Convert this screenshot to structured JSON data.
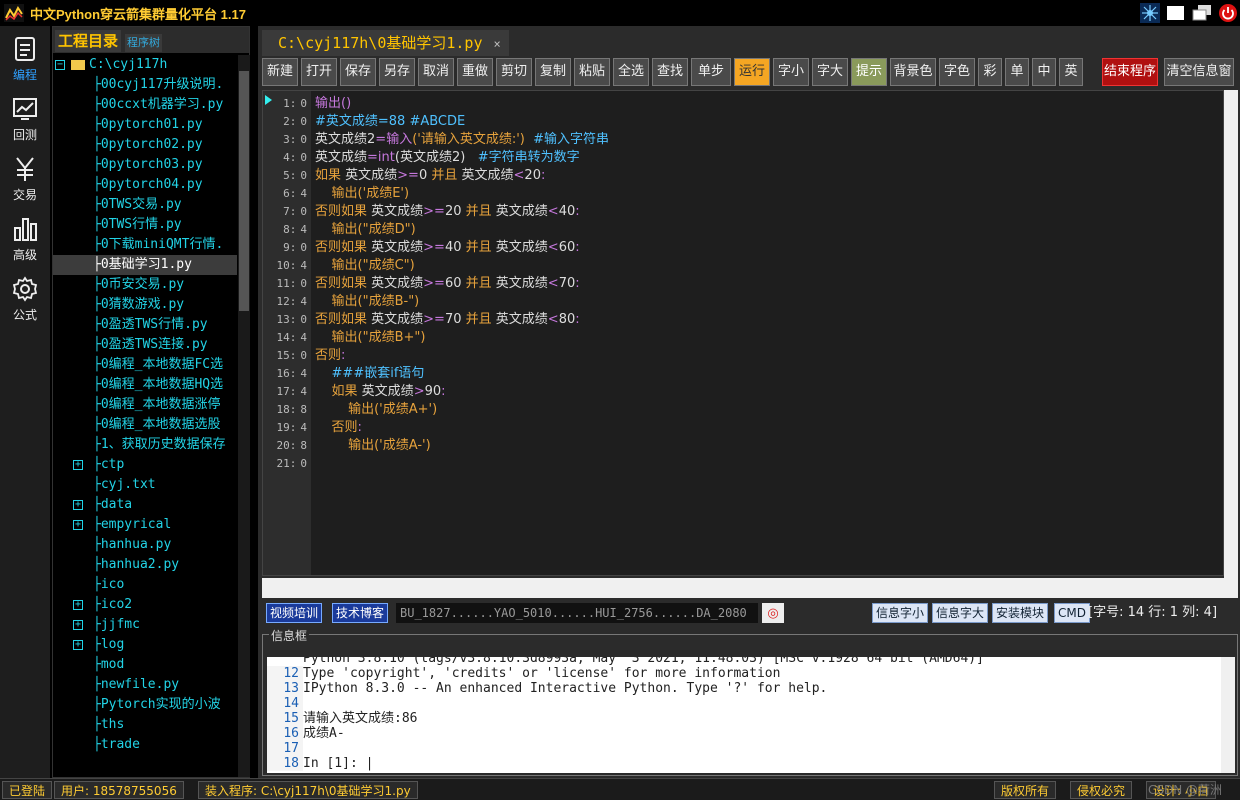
{
  "titlebar": {
    "title": "中文Python穿云箭集群量化平台 1.17"
  },
  "rail": [
    {
      "label": "编程",
      "icon": "document-icon"
    },
    {
      "label": "回测",
      "icon": "chart-line-icon"
    },
    {
      "label": "交易",
      "icon": "yen-icon"
    },
    {
      "label": "高级",
      "icon": "bar-chart-icon"
    },
    {
      "label": "公式",
      "icon": "gear-icon"
    }
  ],
  "project": {
    "tab_main": "工程目录",
    "tab_tree": "程序树",
    "root": "C:\\cyj117h",
    "items": [
      {
        "label": "├00cyj117升级说明.",
        "expand": false
      },
      {
        "label": "├00ccxt机器学习.py",
        "expand": false
      },
      {
        "label": "├0pytorch01.py",
        "expand": false
      },
      {
        "label": "├0pytorch02.py",
        "expand": false
      },
      {
        "label": "├0pytorch03.py",
        "expand": false
      },
      {
        "label": "├0pytorch04.py",
        "expand": false
      },
      {
        "label": "├0TWS交易.py",
        "expand": false
      },
      {
        "label": "├0TWS行情.py",
        "expand": false
      },
      {
        "label": "├0下载miniQMT行情.",
        "expand": false
      },
      {
        "label": "├0基础学习1.py",
        "expand": false,
        "selected": true
      },
      {
        "label": "├0币安交易.py",
        "expand": false
      },
      {
        "label": "├0猜数游戏.py",
        "expand": false
      },
      {
        "label": "├0盈透TWS行情.py",
        "expand": false
      },
      {
        "label": "├0盈透TWS连接.py",
        "expand": false
      },
      {
        "label": "├0编程_本地数据FC选",
        "expand": false
      },
      {
        "label": "├0编程_本地数据HQ选",
        "expand": false
      },
      {
        "label": "├0编程_本地数据涨停",
        "expand": false
      },
      {
        "label": "├0编程_本地数据选股",
        "expand": false
      },
      {
        "label": "├1、获取历史数据保存",
        "expand": false
      },
      {
        "label": "├ctp",
        "expand": true
      },
      {
        "label": "├cyj.txt",
        "expand": false
      },
      {
        "label": "├data",
        "expand": true
      },
      {
        "label": "├empyrical",
        "expand": true
      },
      {
        "label": "├hanhua.py",
        "expand": false
      },
      {
        "label": "├hanhua2.py",
        "expand": false
      },
      {
        "label": "├ico",
        "expand": false
      },
      {
        "label": "├ico2",
        "expand": true
      },
      {
        "label": "├jjfmc",
        "expand": true
      },
      {
        "label": "├log",
        "expand": true
      },
      {
        "label": "├mod",
        "expand": false
      },
      {
        "label": "├newfile.py",
        "expand": false
      },
      {
        "label": "├Pytorch实现的小波",
        "expand": false
      },
      {
        "label": "├ths",
        "expand": false
      },
      {
        "label": "├trade",
        "expand": false
      }
    ]
  },
  "editor": {
    "file_tab": "C:\\cyj117h\\0基础学习1.py",
    "close_glyph": "×",
    "toolbar": [
      "新建",
      "打开",
      "保存",
      "另存",
      "取消",
      "重做",
      "剪切",
      "复制",
      "粘贴",
      "全选",
      "查找",
      "单步",
      "运行",
      "字小",
      "字大",
      "提示",
      "背景色",
      "字色",
      "彩",
      "单",
      "中",
      "英"
    ],
    "stop_button": "结束程序",
    "clear_button": "清空信息窗",
    "lines": [
      {
        "no": "1:",
        "indent": "0",
        "tokens": [
          [
            "fn",
            "输出"
          ],
          [
            "fn",
            "()"
          ]
        ]
      },
      {
        "no": "2:",
        "indent": "0",
        "tokens": [
          [
            "cm",
            "#英文成绩=88 #ABCDE"
          ]
        ]
      },
      {
        "no": "3:",
        "indent": "0",
        "tokens": [
          [
            "",
            "英文成绩2"
          ],
          [
            "fn",
            "="
          ],
          [
            "fn",
            "输入"
          ],
          [
            "str",
            "('请输入英文成绩:')"
          ],
          [
            "",
            "  "
          ],
          [
            "cm",
            "#输入字符串"
          ]
        ]
      },
      {
        "no": "4:",
        "indent": "0",
        "tokens": [
          [
            "",
            "英文成绩"
          ],
          [
            "fn",
            "="
          ],
          [
            "fn",
            "int"
          ],
          [
            "",
            "(英文成绩2)   "
          ],
          [
            "cm",
            "#字符串转为数字"
          ]
        ]
      },
      {
        "no": "5:",
        "indent": "0",
        "tokens": [
          [
            "kw",
            "如果"
          ],
          [
            "",
            " 英文成绩"
          ],
          [
            "fn",
            ">="
          ],
          [
            "",
            "0 "
          ],
          [
            "kw",
            "并且"
          ],
          [
            "",
            " 英文成绩"
          ],
          [
            "fn",
            "<"
          ],
          [
            "",
            "20"
          ],
          [
            "fn",
            ":"
          ]
        ]
      },
      {
        "no": "6:",
        "indent": "4",
        "tokens": [
          [
            "",
            "    "
          ],
          [
            "kw",
            "输出"
          ],
          [
            "str",
            "('成绩E')"
          ]
        ]
      },
      {
        "no": "7:",
        "indent": "0",
        "tokens": [
          [
            "kw",
            "否则如果"
          ],
          [
            "",
            " 英文成绩"
          ],
          [
            "fn",
            ">="
          ],
          [
            "",
            "20 "
          ],
          [
            "kw",
            "并且"
          ],
          [
            "",
            " 英文成绩"
          ],
          [
            "fn",
            "<"
          ],
          [
            "",
            "40"
          ],
          [
            "fn",
            ":"
          ]
        ]
      },
      {
        "no": "8:",
        "indent": "4",
        "tokens": [
          [
            "",
            "    "
          ],
          [
            "kw",
            "输出"
          ],
          [
            "str",
            "(\"成绩D\")"
          ]
        ]
      },
      {
        "no": "9:",
        "indent": "0",
        "tokens": [
          [
            "kw",
            "否则如果"
          ],
          [
            "",
            " 英文成绩"
          ],
          [
            "fn",
            ">="
          ],
          [
            "",
            "40 "
          ],
          [
            "kw",
            "并且"
          ],
          [
            "",
            " 英文成绩"
          ],
          [
            "fn",
            "<"
          ],
          [
            "",
            "60"
          ],
          [
            "fn",
            ":"
          ]
        ]
      },
      {
        "no": "10:",
        "indent": "4",
        "tokens": [
          [
            "",
            "    "
          ],
          [
            "kw",
            "输出"
          ],
          [
            "str",
            "(\"成绩C\")"
          ]
        ]
      },
      {
        "no": "11:",
        "indent": "0",
        "tokens": [
          [
            "kw",
            "否则如果"
          ],
          [
            "",
            " 英文成绩"
          ],
          [
            "fn",
            ">="
          ],
          [
            "",
            "60 "
          ],
          [
            "kw",
            "并且"
          ],
          [
            "",
            " 英文成绩"
          ],
          [
            "fn",
            "<"
          ],
          [
            "",
            "70"
          ],
          [
            "fn",
            ":"
          ]
        ]
      },
      {
        "no": "12:",
        "indent": "4",
        "tokens": [
          [
            "",
            "    "
          ],
          [
            "kw",
            "输出"
          ],
          [
            "str",
            "(\"成绩B-\")"
          ]
        ]
      },
      {
        "no": "13:",
        "indent": "0",
        "tokens": [
          [
            "kw",
            "否则如果"
          ],
          [
            "",
            " 英文成绩"
          ],
          [
            "fn",
            ">="
          ],
          [
            "",
            "70 "
          ],
          [
            "kw",
            "并且"
          ],
          [
            "",
            " 英文成绩"
          ],
          [
            "fn",
            "<"
          ],
          [
            "",
            "80"
          ],
          [
            "fn",
            ":"
          ]
        ]
      },
      {
        "no": "14:",
        "indent": "4",
        "tokens": [
          [
            "",
            "    "
          ],
          [
            "kw",
            "输出"
          ],
          [
            "str",
            "(\"成绩B+\")"
          ]
        ]
      },
      {
        "no": "15:",
        "indent": "0",
        "tokens": [
          [
            "kw",
            "否则"
          ],
          [
            "fn",
            ":"
          ]
        ]
      },
      {
        "no": "16:",
        "indent": "4",
        "tokens": [
          [
            "",
            "    "
          ],
          [
            "cm",
            "###嵌套if语句"
          ]
        ]
      },
      {
        "no": "17:",
        "indent": "4",
        "tokens": [
          [
            "",
            "    "
          ],
          [
            "kw",
            "如果"
          ],
          [
            "",
            " 英文成绩"
          ],
          [
            "fn",
            ">"
          ],
          [
            "",
            "90"
          ],
          [
            "fn",
            ":"
          ]
        ]
      },
      {
        "no": "18:",
        "indent": "8",
        "tokens": [
          [
            "",
            "        "
          ],
          [
            "kw",
            "输出"
          ],
          [
            "str",
            "('成绩A+')"
          ]
        ]
      },
      {
        "no": "19:",
        "indent": "4",
        "tokens": [
          [
            "",
            "    "
          ],
          [
            "kw",
            "否则"
          ],
          [
            "fn",
            ":"
          ]
        ]
      },
      {
        "no": "20:",
        "indent": "8",
        "tokens": [
          [
            "",
            "        "
          ],
          [
            "kw",
            "输出"
          ],
          [
            "str",
            "('成绩A-')"
          ]
        ]
      },
      {
        "no": "21:",
        "indent": "0",
        "tokens": []
      }
    ]
  },
  "statusbar": {
    "video_btn": "视频培训",
    "blog_btn": "技术博客",
    "marquee": "BU_1827......YAO_5010......HUI_2756......DA_2080",
    "stop_glyph": "◎",
    "font_small": "信息字小",
    "font_big": "信息字大",
    "install": "安装模块",
    "cmd": "CMD",
    "info": "[字号: 14  行: 1  列: 4]"
  },
  "console": {
    "title": "信息框",
    "rows": [
      {
        "no": "",
        "text": "Python 3.8.10 (tags/v3.8.10:3d8993a, May  3 2021, 11:48:03) [MSC v.1928 64 bit (AMD64)]"
      },
      {
        "no": "12",
        "text": "Type 'copyright', 'credits' or 'license' for more information"
      },
      {
        "no": "13",
        "text": "IPython 8.3.0 -- An enhanced Interactive Python. Type '?' for help."
      },
      {
        "no": "14",
        "text": ""
      },
      {
        "no": "15",
        "text": "请输入英文成绩:86"
      },
      {
        "no": "16",
        "text": "成绩A-"
      },
      {
        "no": "17",
        "text": ""
      },
      {
        "no": "18",
        "text": "In [1]: |"
      }
    ]
  },
  "bottombar": {
    "logged_in": "已登陆",
    "user": "用户: 18578755056",
    "loaded": "装入程序: C:\\cyj117h\\0基础学习1.py",
    "copyright": "版权所有",
    "piracy": "侵权必究",
    "design": "设计: 小白",
    "watermark": "CSDN @荷洲"
  },
  "colors": {
    "accent": "#ffc400",
    "run": "#f5a623",
    "stop": "#b01010",
    "tree_text": "#22d3e6"
  }
}
